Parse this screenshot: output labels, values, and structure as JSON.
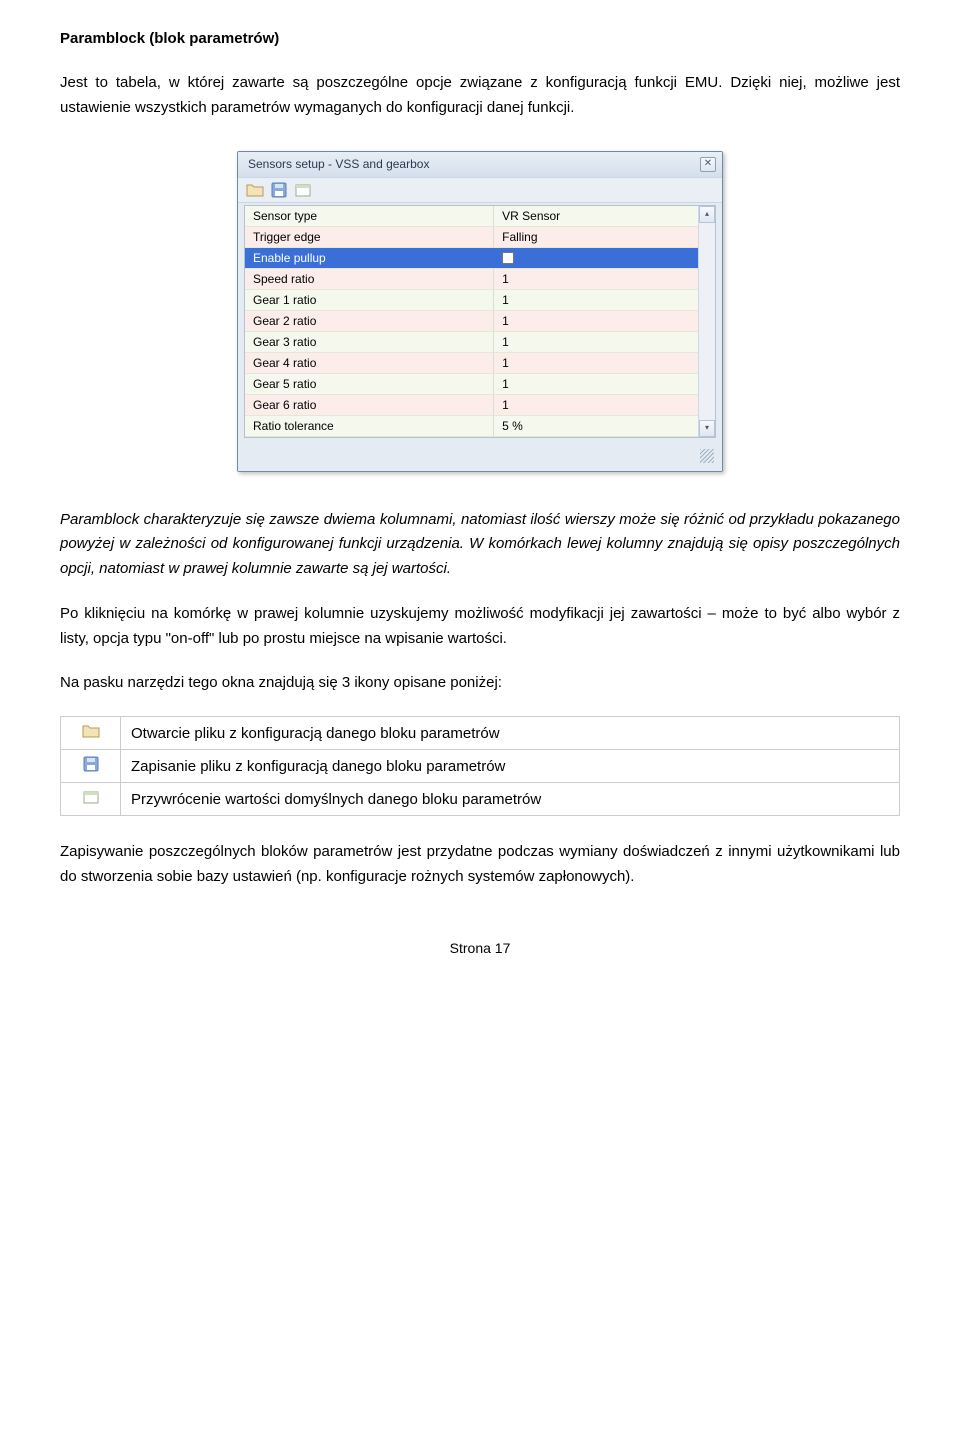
{
  "heading": "Paramblock (blok parametrów)",
  "intro_para": "Jest to tabela, w której zawarte są poszczególne opcje związane z konfiguracją funkcji EMU. Dzięki niej, możliwe jest ustawienie wszystkich parametrów wymaganych do konfiguracji danej funkcji.",
  "window": {
    "title": "Sensors setup - VSS and gearbox",
    "rows": [
      {
        "label": "Sensor type",
        "value": "VR Sensor",
        "cls": "r-normal"
      },
      {
        "label": "Trigger edge",
        "value": "Falling",
        "cls": "r-alt"
      },
      {
        "label": "Enable pullup",
        "value": "__CHECK__",
        "cls": "r-sel"
      },
      {
        "label": "Speed ratio",
        "value": "1",
        "cls": "r-alt"
      },
      {
        "label": "Gear 1 ratio",
        "value": "1",
        "cls": "r-normal"
      },
      {
        "label": "Gear 2 ratio",
        "value": "1",
        "cls": "r-alt"
      },
      {
        "label": "Gear 3 ratio",
        "value": "1",
        "cls": "r-normal"
      },
      {
        "label": "Gear 4 ratio",
        "value": "1",
        "cls": "r-alt"
      },
      {
        "label": "Gear 5 ratio",
        "value": "1",
        "cls": "r-normal"
      },
      {
        "label": "Gear 6 ratio",
        "value": "1",
        "cls": "r-alt"
      },
      {
        "label": "Ratio tolerance",
        "value": "5 %",
        "cls": "r-normal"
      }
    ]
  },
  "after_para1": "Paramblock charakteryzuje się zawsze dwiema kolumnami, natomiast ilość wierszy może się różnić od przykładu pokazanego powyżej w zależności od konfigurowanej funkcji urządzenia. W komórkach lewej kolumny znajdują się opisy poszczególnych opcji, natomiast w prawej kolumnie zawarte są jej wartości.",
  "after_para2": "Po kliknięciu na komórkę w prawej kolumnie uzyskujemy możliwość modyfikacji jej zawartości – może to być albo wybór z listy, opcja typu \"on-off\" lub po prostu miejsce na wpisanie wartości.",
  "toolbar_intro": "Na pasku narzędzi tego okna znajdują się 3 ikony opisane poniżej:",
  "icon_table": [
    {
      "icon": "folder",
      "desc": "Otwarcie pliku z konfiguracją danego bloku parametrów"
    },
    {
      "icon": "save",
      "desc": "Zapisanie pliku z konfiguracją danego bloku parametrów"
    },
    {
      "icon": "default",
      "desc": "Przywrócenie wartości domyślnych danego bloku parametrów"
    }
  ],
  "closing_para": "Zapisywanie poszczególnych bloków parametrów jest przydatne podczas wymiany doświadczeń z innymi użytkownikami lub do stworzenia sobie bazy ustawień (np. konfiguracje rożnych systemów zapłonowych).",
  "page_footer": "Strona 17"
}
